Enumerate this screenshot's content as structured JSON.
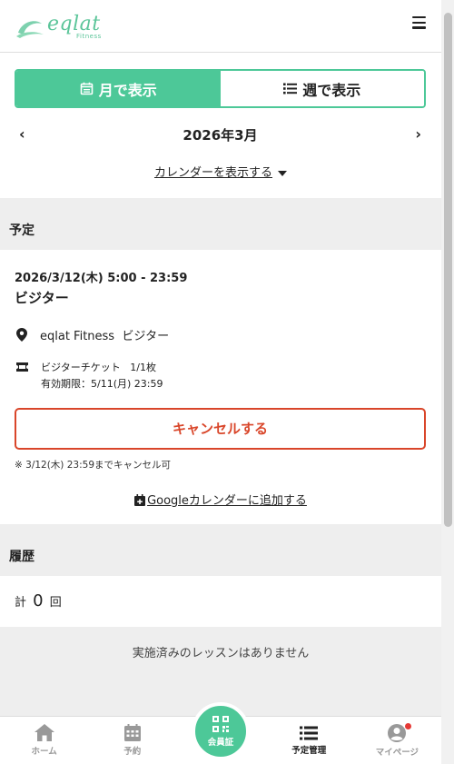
{
  "header": {
    "logo_text": "eqlat",
    "logo_sub": "Fitness"
  },
  "view_toggle": {
    "month_label": "月で表示",
    "week_label": "週で表示",
    "active": "month"
  },
  "month_nav": {
    "prev": "‹",
    "label": "2026年3月",
    "next": "›"
  },
  "show_calendar_label": "カレンダーを表示する",
  "schedule": {
    "section_title": "予定",
    "event": {
      "datetime": "2026/3/12(木) 5:00 - 23:59",
      "title": "ビジター",
      "location_name": "eqlat Fitness",
      "location_type": "ビジター",
      "ticket_name": "ビジターチケット",
      "ticket_count": "1/1枚",
      "ticket_expiry": "有効期限：5/11(月) 23:59",
      "cancel_button": "キャンセルする",
      "cancel_note": "※ 3/12(木) 23:59までキャンセル可",
      "gcal_label": "Googleカレンダーに追加する"
    }
  },
  "history": {
    "section_title": "履歴",
    "count_prefix": "計",
    "count_value": "0",
    "count_suffix": "回",
    "empty_message": "実施済みのレッスンはありません"
  },
  "bottom_nav": {
    "home": "ホーム",
    "reserve": "予約",
    "member_card": "会員証",
    "schedule": "予定管理",
    "mypage": "マイページ"
  },
  "colors": {
    "accent": "#4dc898",
    "danger": "#d9462a"
  }
}
